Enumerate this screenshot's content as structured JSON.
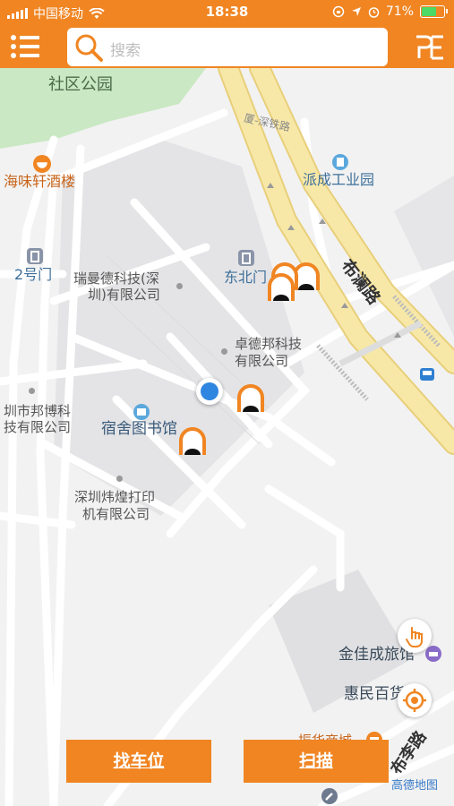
{
  "status_bar": {
    "carrier": "中国移动",
    "time": "18:38",
    "battery": "71%",
    "battery_level": 0.71
  },
  "search": {
    "placeholder": "搜索"
  },
  "map": {
    "labels": {
      "park": "社区公园",
      "restaurant": "海味轩酒楼",
      "railway": "厦-深铁路",
      "industrial_park": "派成工业园",
      "gate2": "2号门",
      "northeast_gate": "东北门",
      "company1_line1": "瑞曼德科技(深",
      "company1_line2": "圳)有限公司",
      "road_bulan": "布澜路",
      "company2_line1": "卓德邦科技",
      "company2_line2": "有限公司",
      "company3_line1": "圳市邦博科",
      "company3_line2": "技有限公司",
      "library": "宿舍图书馆",
      "company4_line1": "深圳炜煌打印",
      "company4_line2": "机有限公司",
      "hotel": "金佳成旅馆",
      "store": "惠民百货",
      "road_buli": "布李路",
      "partial": "振华商城",
      "attribution": "高德地图"
    }
  },
  "actions": {
    "find_parking": "找车位",
    "scan": "扫描"
  },
  "colors": {
    "brand": "#f08522",
    "road_major": "#f7e8a8",
    "location": "#2f86e0"
  }
}
